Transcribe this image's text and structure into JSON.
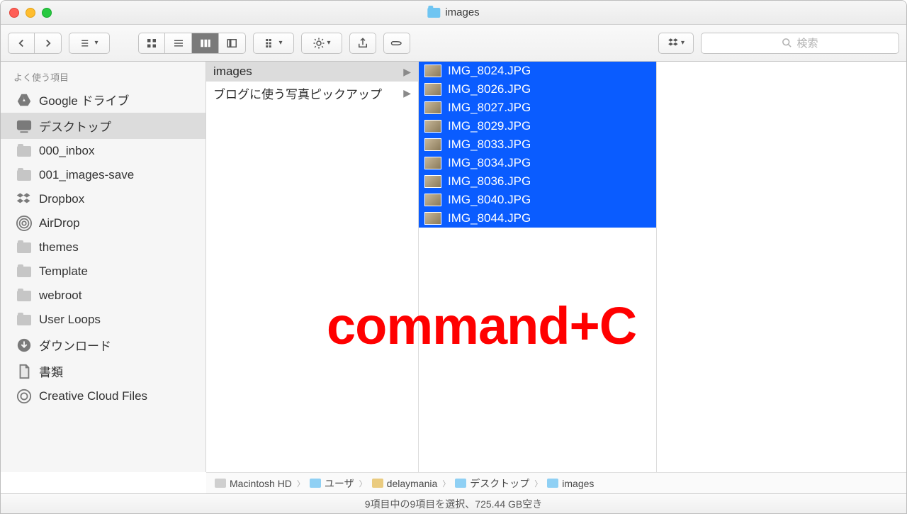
{
  "window": {
    "title": "images"
  },
  "toolbar": {
    "search_placeholder": "検索"
  },
  "sidebar": {
    "section_label": "よく使う項目",
    "items": [
      {
        "label": "Google ドライブ",
        "icon": "gdrive"
      },
      {
        "label": "デスクトップ",
        "icon": "desktop",
        "selected": true
      },
      {
        "label": "000_inbox",
        "icon": "folder"
      },
      {
        "label": "001_images-save",
        "icon": "folder"
      },
      {
        "label": "Dropbox",
        "icon": "dropbox"
      },
      {
        "label": "AirDrop",
        "icon": "airdrop"
      },
      {
        "label": "themes",
        "icon": "folder"
      },
      {
        "label": "Template",
        "icon": "folder"
      },
      {
        "label": "webroot",
        "icon": "folder"
      },
      {
        "label": "User Loops",
        "icon": "folder"
      },
      {
        "label": "ダウンロード",
        "icon": "download"
      },
      {
        "label": "書類",
        "icon": "document"
      },
      {
        "label": "Creative Cloud Files",
        "icon": "cc"
      }
    ]
  },
  "column1": {
    "items": [
      {
        "label": "images",
        "selected": true
      },
      {
        "label": "ブログに使う写真ピックアップ"
      }
    ]
  },
  "files": [
    "IMG_8024.JPG",
    "IMG_8026.JPG",
    "IMG_8027.JPG",
    "IMG_8029.JPG",
    "IMG_8033.JPG",
    "IMG_8034.JPG",
    "IMG_8036.JPG",
    "IMG_8040.JPG",
    "IMG_8044.JPG"
  ],
  "pathbar": [
    "Macintosh HD",
    "ユーザ",
    "delaymania",
    "デスクトップ",
    "images"
  ],
  "statusbar": "9項目中の9項目を選択、725.44 GB空き",
  "overlay": "command+C"
}
